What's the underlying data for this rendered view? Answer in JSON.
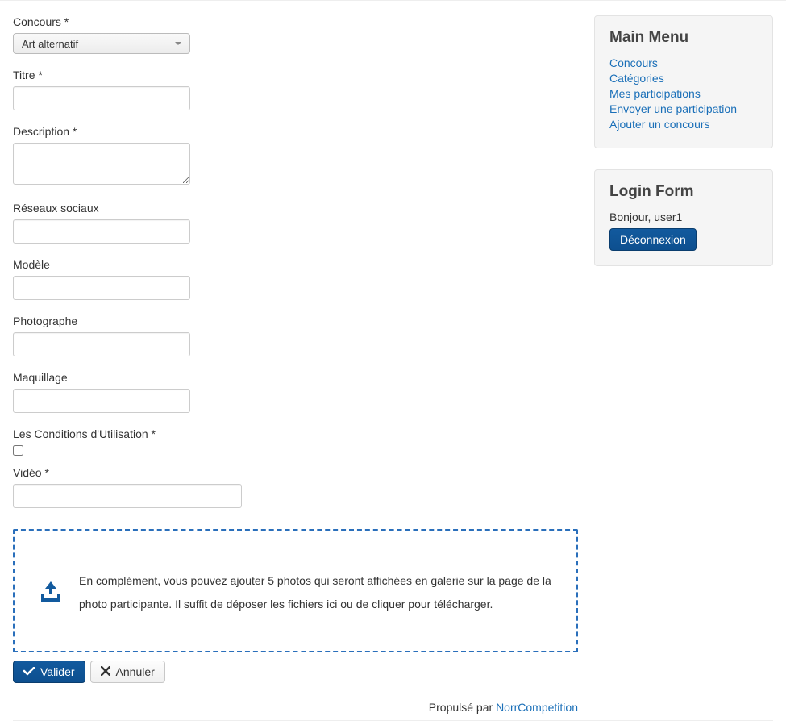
{
  "form": {
    "concours": {
      "label": "Concours *",
      "value": "Art alternatif"
    },
    "titre": {
      "label": "Titre *",
      "value": ""
    },
    "description": {
      "label": "Description *",
      "value": ""
    },
    "reseaux": {
      "label": "Réseaux sociaux",
      "value": ""
    },
    "modele": {
      "label": "Modèle",
      "value": ""
    },
    "photographe": {
      "label": "Photographe",
      "value": ""
    },
    "maquillage": {
      "label": "Maquillage",
      "value": ""
    },
    "conditions": {
      "label": "Les Conditions d'Utilisation *"
    },
    "video": {
      "label": "Vidéo *",
      "value": ""
    }
  },
  "dropzone": {
    "text": "En complément, vous pouvez ajouter 5 photos qui seront affichées en galerie sur la page de la photo participante. Il suffit de déposer les fichiers ici ou de cliquer pour télécharger."
  },
  "buttons": {
    "submit": "Valider",
    "cancel": "Annuler"
  },
  "footer": {
    "prefix": "Propulsé par ",
    "link": "NorrCompetition"
  },
  "sidebar": {
    "menu": {
      "title": "Main Menu",
      "items": [
        "Concours",
        "Catégories",
        "Mes participations",
        "Envoyer une participation",
        "Ajouter un concours"
      ]
    },
    "login": {
      "title": "Login Form",
      "greeting": "Bonjour, user1",
      "logout": "Déconnexion"
    }
  }
}
